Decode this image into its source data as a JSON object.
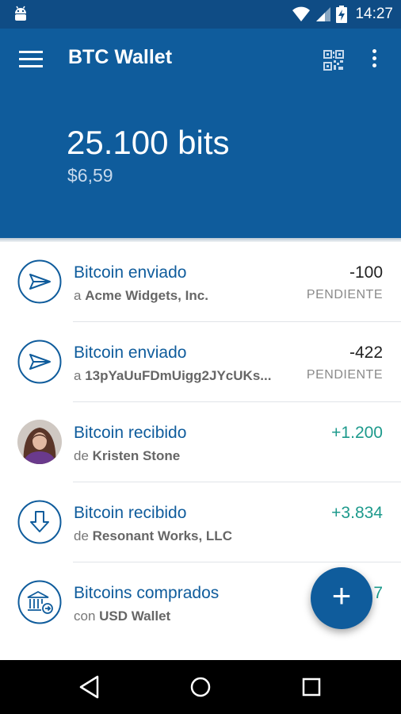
{
  "status_bar": {
    "time": "14:27"
  },
  "app_bar": {
    "title": "BTC Wallet"
  },
  "header": {
    "balance": "25.100 bits",
    "fiat": "$6,59"
  },
  "transactions": [
    {
      "title": "Bitcoin enviado",
      "prefix": "a",
      "party": "Acme Widgets, Inc.",
      "amount": "-100",
      "status": "PENDIENTE",
      "icon": "send-icon"
    },
    {
      "title": "Bitcoin enviado",
      "prefix": "a",
      "party": "13pYaUuFDmUigg2JYcUKs...",
      "amount": "-422",
      "status": "PENDIENTE",
      "icon": "send-icon"
    },
    {
      "title": "Bitcoin recibido",
      "prefix": "de",
      "party": "Kristen Stone",
      "amount": "+1.200",
      "status": "",
      "icon": "avatar"
    },
    {
      "title": "Bitcoin recibido",
      "prefix": "de",
      "party": "Resonant Works, LLC",
      "amount": "+3.834",
      "status": "",
      "icon": "receive-icon"
    },
    {
      "title": "Bitcoins comprados",
      "prefix": "con",
      "party": "USD Wallet",
      "amount": "7",
      "status": "",
      "icon": "bank-icon"
    }
  ],
  "fab": {
    "label": "+"
  },
  "colors": {
    "primary": "#0f5c9c",
    "status_bar": "#0f4c85",
    "positive": "#1d9a8c",
    "muted": "#8a8a8a"
  }
}
